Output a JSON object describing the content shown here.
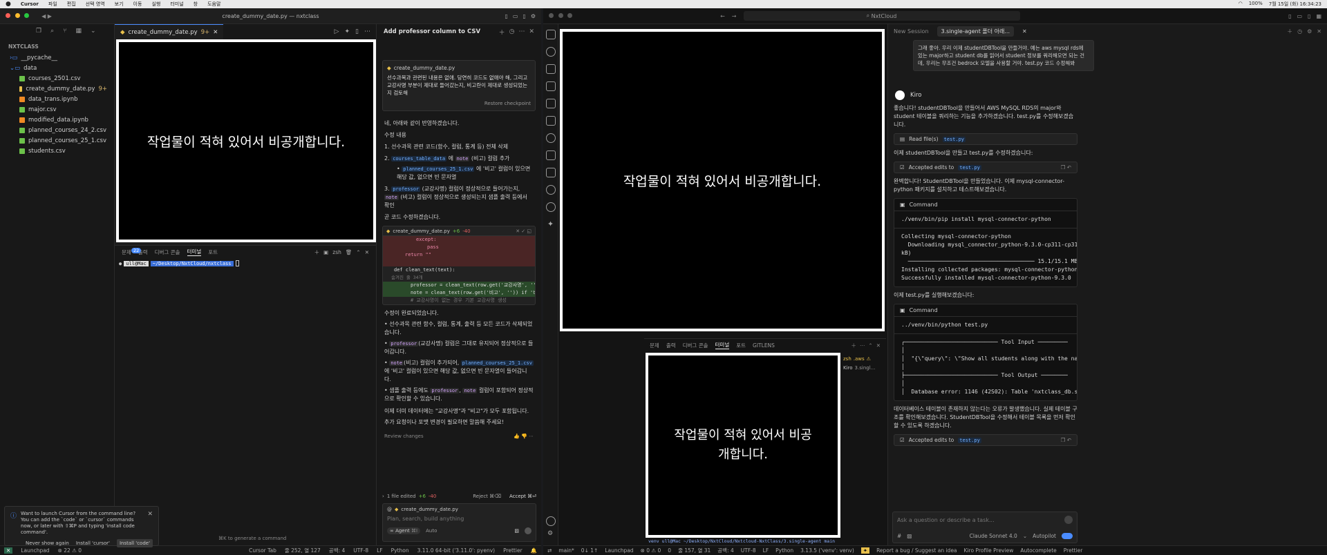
{
  "menubar": {
    "app": "Cursor",
    "items": [
      "파일",
      "편집",
      "선택 영역",
      "보기",
      "이동",
      "실행",
      "터미널",
      "창",
      "도움말"
    ],
    "right_items": [
      "100%",
      "7월 15일 (화) 16:34:23"
    ]
  },
  "cursor": {
    "window_title": "create_dummy_date.py — nxtclass",
    "explorer_title": "NXTCLASS",
    "tree": [
      {
        "label": "__pycache__",
        "type": "folder",
        "badge": ""
      },
      {
        "label": "data",
        "type": "folder-open",
        "badge": ""
      },
      {
        "label": "courses_2501.csv",
        "type": "csv",
        "badge": ""
      },
      {
        "label": "create_dummy_date.py",
        "type": "py",
        "badge": "9+"
      },
      {
        "label": "data_trans.ipynb",
        "type": "nb",
        "badge": ""
      },
      {
        "label": "major.csv",
        "type": "csv",
        "badge": ""
      },
      {
        "label": "modified_data.ipynb",
        "type": "nb",
        "badge": ""
      },
      {
        "label": "planned_courses_24_2.csv",
        "type": "csv",
        "badge": ""
      },
      {
        "label": "planned_courses_25_1.csv",
        "type": "csv",
        "badge": ""
      },
      {
        "label": "students.csv",
        "type": "csv",
        "badge": ""
      }
    ],
    "editor_tab": "create_dummy_date.py",
    "editor_tab_badge": "9+",
    "redacted_text": "작업물이 적혀 있어서 비공개합니다.",
    "panel_tabs": [
      "문제",
      "출력",
      "디버그 콘솔",
      "터미널",
      "포트"
    ],
    "panel_badge": "22",
    "terminal_shell": "zsh",
    "terminal_prompt_user": "ull@Mac",
    "terminal_prompt_path": "~/Desktop/NxtCloud/nxtclass",
    "notification": {
      "text": "Want to launch Cursor from the command line? You can add the `code` or `cursor` commands now, or later with ⇧⌘P and typing 'install code command'.",
      "btn_never": "Never show again",
      "btn_cursor": "Install 'cursor'",
      "btn_code": "Install 'code'"
    },
    "generate_hint": "⌘K to generate a command",
    "chat": {
      "title": "Add professor column to CSV",
      "context_file": "create_dummy_date.py",
      "user_msg": "선수과목과 관련된 내용은 없애. 당연히 코드도 없애야 해, 그리고 교강사명 부분이 제대로 들어갔는지, 비고란이 제대로 생성되었는지 검토해",
      "restore": "Restore checkpoint",
      "intro": "네, 아래와 같이 반영하겠습니다.",
      "changes_title": "수정 내용",
      "step1": "1. 선수과목 관련 코드(함수, 컬럼, 통계 등) 전체 삭제",
      "step2_a": "2.",
      "step2_code1": "courses_table_data",
      "step2_b": "에",
      "step2_code2": "note",
      "step2_c": "(비고) 컬럼 추가",
      "step2_sub_code": "planned_courses_25_1.csv",
      "step2_sub_text": "에 '비고' 컬럼이 있으면 해당 값, 없으면 빈 문자열",
      "step3_code1": "professor",
      "step3_a": "(교강사명) 컬럼이 정상적으로 들어가는지,",
      "step3_code2": "note",
      "step3_b": "(비고) 컬럼이 정상적으로 생성되는지 샘플 출력 등에서 확인",
      "step3_num": "3.",
      "soon": "곧 코드 수정하겠습니다.",
      "diff_file": "create_dummy_date.py",
      "diff_plus": "+6",
      "diff_minus": "-40",
      "diff_lines": [
        "except:",
        "pass",
        "return \"\"",
        "",
        "def clean_text(text):",
        "",
        "professor = clean_text(row.get('교강사명', '')) if '교강사",
        "note = clean_text(row.get('비고', '')) if '비고' in row e",
        "# 교강사명이 없는 경우 기본 교강사명 생성"
      ],
      "diff_collapsed": "숨겨진 줄 34개",
      "done": "수정이 완료되었습니다.",
      "b1": "선수과목 관련 함수, 컬럼, 통계, 출력 등 모든 코드가 삭제되었습니다.",
      "b2_code": "professor",
      "b2": "(교강사명) 컬럼은 그대로 유지되어 정상적으로 들어갑니다.",
      "b3_code": "note",
      "b3_a": "(비고) 컬럼이 추가되어,",
      "b3_code2": "planned_courses_25_1.csv",
      "b3_b": "에 '비고' 컬럼이 있으면 해당 값, 없으면 빈 문자열이 들어갑니다.",
      "b4_a": "샘플 출력 등에도",
      "b4_code1": "professor",
      "b4_code2": "note",
      "b4_b": "컬럼이 포함되어 정상적으로 확인할 수 있습니다.",
      "summary1": "이제 더미 데이터에는 \"교강사명\"과 \"비고\"가 모두 포함됩니다.",
      "summary2": "추가 요청이나 포맷 변경이 필요하면 말씀해 주세요!",
      "review": "Review changes",
      "edited": "1 file edited",
      "edited_plus": "+6",
      "edited_minus": "-40",
      "reject": "Reject ⌘⌫",
      "accept": "Accept ⌘⏎",
      "input_file": "create_dummy_date.py",
      "input_placeholder": "Plan, search, build anything",
      "agent": "Agent",
      "agent_key": "⌘I",
      "auto": "Auto"
    },
    "status": {
      "launchpad": "Launchpad",
      "problems": "⊗ 22  ⚠ 0",
      "cursor_tab": "Cursor Tab",
      "position": "줄 252, 열 127",
      "spaces": "공백: 4",
      "encoding": "UTF-8",
      "eol": "LF",
      "language": "Python",
      "interpreter": "3.11.0 64-bit ('3.11.0': pyenv)",
      "prettier": "Prettier"
    }
  },
  "kiro": {
    "search": "NxtCloud",
    "redacted_text_1": "작업물이 적혀 있어서 비공개합니다.",
    "redacted_text_2": "작업물이 적혀 있어서 비공개합니다.",
    "panel_tabs": [
      "문제",
      "출력",
      "디버그 콘솔",
      "터미널",
      "포트",
      "GITLENS"
    ],
    "term_list": [
      {
        "label": "zsh",
        "suffix": ".aws"
      },
      {
        "label": "Kiro",
        "suffix": "3.singl..."
      }
    ],
    "term_prompt": "venv ull@Mac ~/Desktop/NxtCloud/Nxtcloud-NxtClass/3.single-agent main",
    "tab_new": "New Session",
    "tab_active": "3.single-agent 폴더 아래...",
    "user_msg": "그래 좋아. 우리 이제 studentDBTool을 만들거야. 예는 aws mysql rds에 있는 major하고 student db를 읽어서 student 정보를 쿼리해오면 되는 건데, 우리는 무조건 bedrock 모델을 사용할 거야. test.py 코드 수정해봐",
    "agent_name": "Kiro",
    "m1": "좋습니다! studentDBTool을 만들어서 AWS MySQL RDS의 major와 student 테이블을 쿼리하는 기능을 추가하겠습니다. test.py를 수정해보겠습니다.",
    "read_files": "Read file(s)",
    "file_chip": "test.py",
    "m2": "이제 studentDBTool을 만들고 test.py를 수정하겠습니다:",
    "accepted": "Accepted edits to",
    "m3": "완벽합니다! StudentDBTool을 만들었습니다. 이제 mysql-connector-python 패키지를 설치하고 테스트해보겠습니다.",
    "command": "Command",
    "cmd1": "./venv/bin/pip install mysql-connector-python",
    "out1": "Collecting mysql-connector-python\n  Downloading mysql_connector_python-9.3.0-cp311-cp311-mac\nkB)\n  ────────────────────────────────────── 15.1/15.1 MB 3\nInstalling collected packages: mysql-connector-python\nSuccessfully installed mysql-connector-python-9.3.0",
    "m4": "이제 test.py를 실행해보겠습니다:",
    "cmd2": "../venv/bin/python test.py",
    "out2": "╭──────────────────────────── Tool Input ─────────\n│\n│  \"{\\\"query\\\": \\\"Show all students along with the name of\n│\n├──────────────────────────── Tool Output ────────\n│\n│  Database error: 1146 (42S02): Table 'nxtclass_db.studen",
    "m5": "데이터베이스 테이블이 존재하지 않는다는 오류가 발생했습니다. 실제 테이블 구조를 확인해보겠습니다. StudentDBTool을 수정해서 테이블 목록을 먼저 확인할 수 있도록 하겠습니다.",
    "input_placeholder": "Ask a question or describe a task...",
    "model": "Claude Sonnet 4.0",
    "autopilot": "Autopilot",
    "status": {
      "branch": "main*",
      "sync": "0↓ 1↑",
      "launchpad": "Launchpad",
      "problems": "⊗ 0 ⚠ 0",
      "ports": "0",
      "position": "줄 157, 열 31",
      "spaces": "공백: 4",
      "encoding": "UTF-8",
      "eol": "LF",
      "language": "Python",
      "interpreter": "3.13.5 ('venv': venv)",
      "report": "Report a bug / Suggest an idea",
      "preview": "Kiro Profile Preview",
      "autocomplete": "Autocomplete",
      "prettier": "Prettier"
    }
  },
  "colors": {
    "accent": "#4a8cff",
    "py": "#e8c04b",
    "csv": "#6cc24a",
    "nb": "#f08a24",
    "diff_add": "#2a4a2a",
    "diff_del": "#4a2525"
  }
}
